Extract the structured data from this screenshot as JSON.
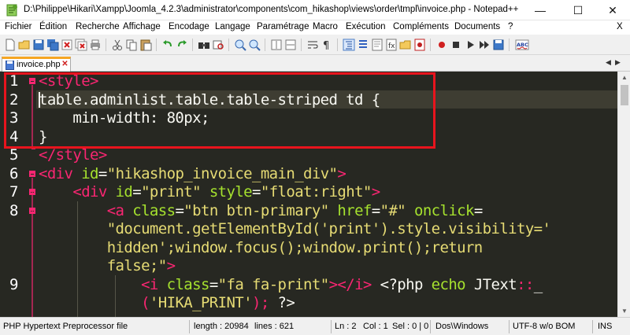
{
  "window": {
    "title": "D:\\Philippe\\Hikari\\Xampp\\Joomla_4.2.3\\administrator\\components\\com_hikashop\\views\\order\\tmpl\\invoice.php - Notepad++",
    "minimize_glyph": "—",
    "maximize_glyph": "☐",
    "close_glyph": "✕"
  },
  "menu": {
    "items": [
      "Fichier",
      "Édition",
      "Recherche",
      "Affichage",
      "Encodage",
      "Langage",
      "Paramétrage",
      "Macro",
      "Exécution",
      "Compléments",
      "Documents",
      "?"
    ],
    "close_glyph": "X"
  },
  "toolbar": {
    "icons": [
      "new-file-icon",
      "open-file-icon",
      "save-icon",
      "save-all-icon",
      "close-icon",
      "close-all-icon",
      "print-icon",
      "cut-icon",
      "copy-icon",
      "paste-icon",
      "undo-icon",
      "redo-icon",
      "find-icon",
      "replace-icon",
      "zoom-in-icon",
      "zoom-out-icon",
      "sync-vertical-icon",
      "sync-horizontal-icon",
      "word-wrap-icon",
      "show-all-chars-icon",
      "indent-guide-icon",
      "udl-icon",
      "doc-map-icon",
      "function-list-icon",
      "folder-workspace-icon",
      "monitoring-icon",
      "record-macro-icon",
      "stop-macro-icon",
      "play-macro-icon",
      "run-macro-multiple-icon",
      "save-macro-icon",
      "spell-check-icon"
    ]
  },
  "tab": {
    "label": "invoice.php",
    "close_glyph": "✕"
  },
  "editor": {
    "line_numbers": [
      "1",
      "2",
      "3",
      "4",
      "5",
      "6",
      "7",
      "8",
      "9"
    ],
    "lines": [
      [
        {
          "t": "tag",
          "s": "<style>"
        }
      ],
      [
        {
          "t": "plain",
          "s": "table.adminlist.table.table-striped td {"
        }
      ],
      [
        {
          "t": "plain",
          "s": "    min-width: 80px;"
        }
      ],
      [
        {
          "t": "plain",
          "s": "}"
        }
      ],
      [
        {
          "t": "tag",
          "s": "</style>"
        }
      ],
      [
        {
          "t": "tag",
          "s": "<div "
        },
        {
          "t": "attr",
          "s": "id"
        },
        {
          "t": "plain",
          "s": "="
        },
        {
          "t": "str",
          "s": "\"hikashop_invoice_main_div\""
        },
        {
          "t": "tag",
          "s": ">"
        }
      ],
      [
        {
          "t": "plain",
          "s": "    "
        },
        {
          "t": "tag",
          "s": "<div "
        },
        {
          "t": "attr",
          "s": "id"
        },
        {
          "t": "plain",
          "s": "="
        },
        {
          "t": "str",
          "s": "\"print\""
        },
        {
          "t": "plain",
          "s": " "
        },
        {
          "t": "attr",
          "s": "style"
        },
        {
          "t": "plain",
          "s": "="
        },
        {
          "t": "str",
          "s": "\"float:right\""
        },
        {
          "t": "tag",
          "s": ">"
        }
      ],
      [
        {
          "t": "plain",
          "s": "        "
        },
        {
          "t": "tag",
          "s": "<a "
        },
        {
          "t": "attr",
          "s": "class"
        },
        {
          "t": "plain",
          "s": "="
        },
        {
          "t": "str",
          "s": "\"btn btn-primary\""
        },
        {
          "t": "plain",
          "s": " "
        },
        {
          "t": "attr",
          "s": "href"
        },
        {
          "t": "plain",
          "s": "="
        },
        {
          "t": "str",
          "s": "\"#\""
        },
        {
          "t": "plain",
          "s": " "
        },
        {
          "t": "attr",
          "s": "onclick"
        },
        {
          "t": "plain",
          "s": "="
        }
      ],
      [
        {
          "t": "plain",
          "s": "        "
        },
        {
          "t": "str",
          "s": "\"document.getElementById('print').style.visibility='"
        }
      ],
      [
        {
          "t": "plain",
          "s": "        "
        },
        {
          "t": "str",
          "s": "hidden';window.focus();window.print();return"
        }
      ],
      [
        {
          "t": "plain",
          "s": "        "
        },
        {
          "t": "str",
          "s": "false;\""
        },
        {
          "t": "tag",
          "s": ">"
        }
      ],
      [
        {
          "t": "plain",
          "s": "            "
        },
        {
          "t": "tag",
          "s": "<i "
        },
        {
          "t": "attr",
          "s": "class"
        },
        {
          "t": "plain",
          "s": "="
        },
        {
          "t": "str",
          "s": "\"fa fa-print\""
        },
        {
          "t": "tag",
          "s": "></i>"
        },
        {
          "t": "plain",
          "s": " <?php "
        },
        {
          "t": "attr",
          "s": "echo"
        },
        {
          "t": "plain",
          "s": " JText"
        },
        {
          "t": "tag",
          "s": "::"
        },
        {
          "t": "plain",
          "s": "_"
        }
      ],
      [
        {
          "t": "plain",
          "s": "            "
        },
        {
          "t": "tag",
          "s": "("
        },
        {
          "t": "str",
          "s": "'HIKA_PRINT'"
        },
        {
          "t": "tag",
          "s": ");"
        },
        {
          "t": "plain",
          "s": " ?>"
        }
      ]
    ]
  },
  "statusbar": {
    "file_type": "PHP Hypertext Preprocessor file",
    "length": "length : 20984",
    "lines": "lines : 621",
    "ln": "Ln : 2",
    "col": "Col : 1",
    "sel": "Sel : 0 | 0",
    "eol": "Dos\\Windows",
    "encoding": "UTF-8 w/o BOM",
    "mode": "INS"
  },
  "colors": {
    "editor_bg": "#272822",
    "tag": "#f92672",
    "attr": "#a6e22e",
    "string": "#e6db74",
    "text": "#f8f8f2",
    "annotation_box": "#e8141d",
    "tab_accent": "#f6a623"
  }
}
